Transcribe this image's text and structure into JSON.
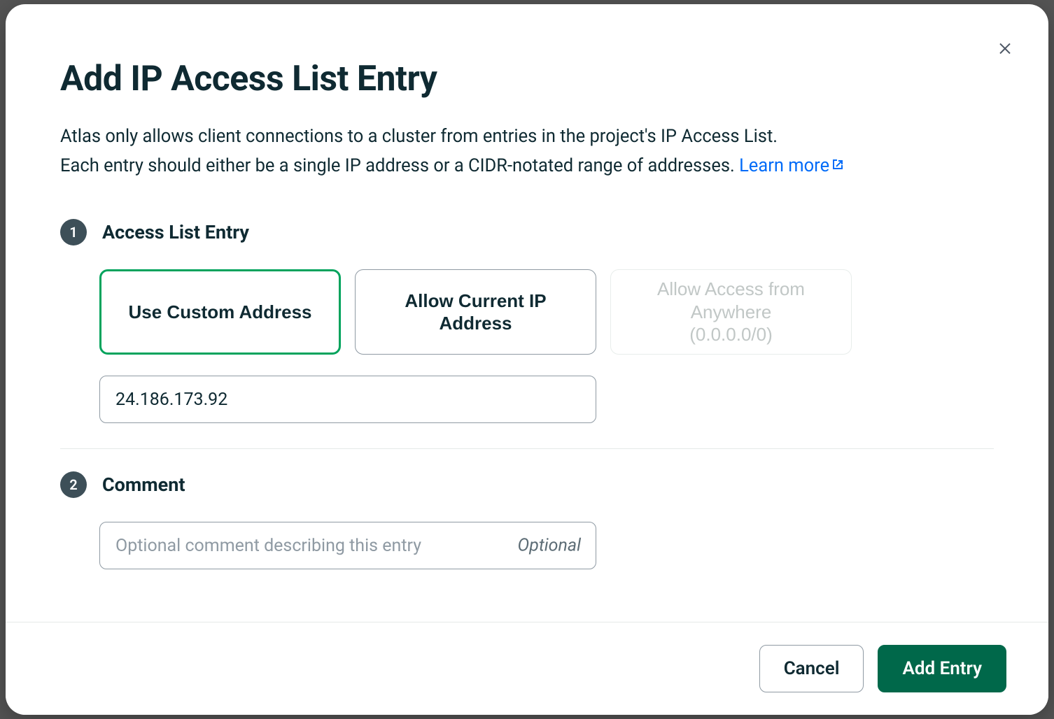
{
  "modal": {
    "title": "Add IP Access List Entry",
    "description_line1": "Atlas only allows client connections to a cluster from entries in the project's IP Access List.",
    "description_line2_prefix": "Each entry should either be a single IP address or a CIDR-notated range of addresses. ",
    "learn_more_label": "Learn more"
  },
  "step1": {
    "number": "1",
    "title": "Access List Entry",
    "options": {
      "custom": "Use Custom Address",
      "current": "Allow Current IP Address",
      "anywhere_line1": "Allow Access from Anywhere",
      "anywhere_line2": "(0.0.0.0/0)"
    },
    "ip_value": "24.186.173.92"
  },
  "step2": {
    "number": "2",
    "title": "Comment",
    "placeholder": "Optional comment describing this entry",
    "optional_tag": "Optional",
    "value": ""
  },
  "footer": {
    "cancel": "Cancel",
    "confirm": "Add Entry"
  }
}
